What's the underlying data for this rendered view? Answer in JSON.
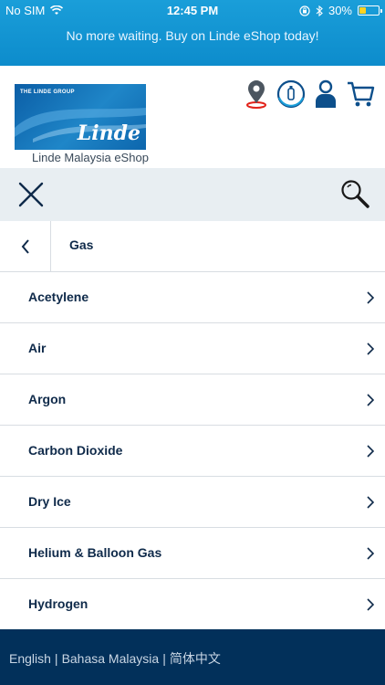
{
  "status_bar": {
    "carrier": "No SIM",
    "time": "12:45 PM",
    "battery": "30%",
    "battery_level": 0.3
  },
  "promo": {
    "text": "No more waiting. Buy on Linde eShop today!"
  },
  "header": {
    "logo_group_text": "THE LINDE GROUP",
    "logo_name": "Linde",
    "eshop_label": "Linde Malaysia eShop",
    "icons": [
      "location-icon",
      "cylinder-info-icon",
      "account-icon",
      "cart-icon"
    ]
  },
  "toolbar": {
    "close_icon": "close-icon",
    "search_icon": "search-icon"
  },
  "category": {
    "title": "Gas"
  },
  "items": [
    {
      "label": "Acetylene"
    },
    {
      "label": "Air"
    },
    {
      "label": "Argon"
    },
    {
      "label": "Carbon Dioxide"
    },
    {
      "label": "Dry Ice"
    },
    {
      "label": "Helium & Balloon Gas"
    },
    {
      "label": "Hydrogen"
    }
  ],
  "footer": {
    "languages": [
      "English",
      "Bahasa Malaysia",
      "简体中文"
    ],
    "separator": "|"
  },
  "colors": {
    "top_band": "#1a9ed9",
    "primary_text": "#0f2a4a",
    "toolbar_bg": "#e8eef2",
    "footer_bg": "#02305a",
    "accent_red": "#e2231a",
    "icon_blue": "#0d4f8b"
  }
}
